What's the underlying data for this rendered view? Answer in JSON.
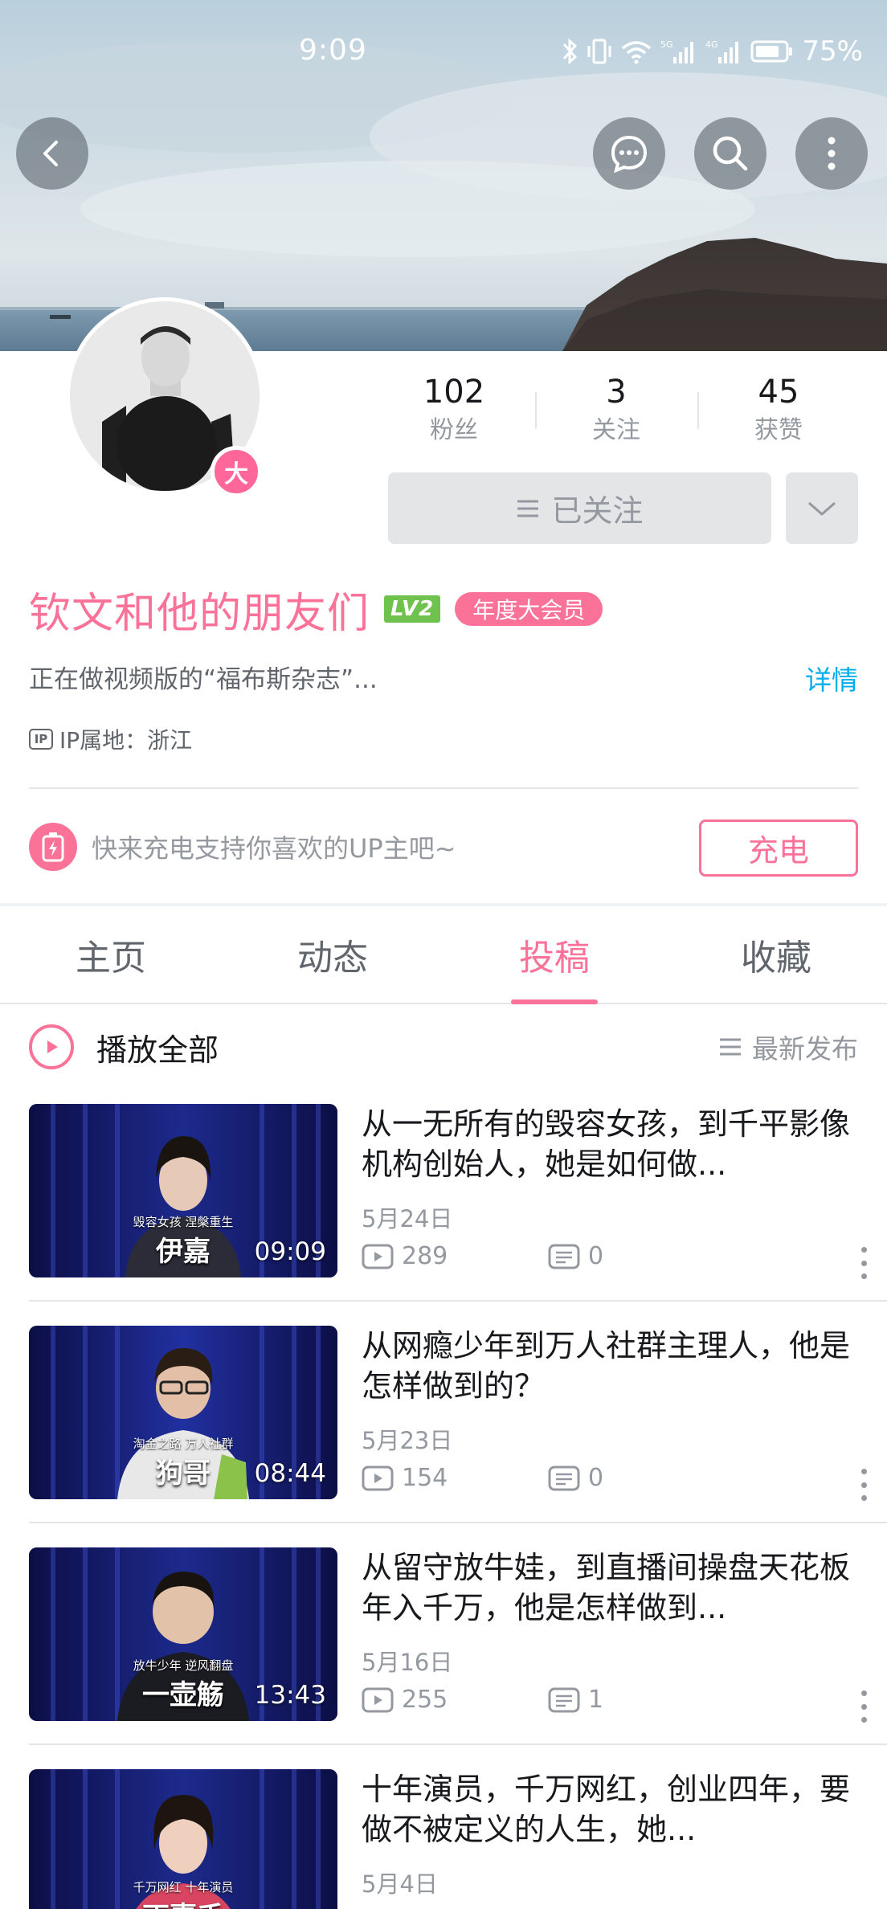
{
  "status_bar": {
    "time": "9:09",
    "battery": "75%"
  },
  "profile": {
    "avatar_badge": "大",
    "name": "钦文和他的朋友们",
    "level": "LV2",
    "vip": "年度大会员",
    "bio": "正在做视频版的“福布斯杂志”...",
    "bio_detail": "详情",
    "ip_icon": "IP",
    "ip": "IP属地：浙江"
  },
  "stats": [
    {
      "num": "102",
      "label": "粉丝"
    },
    {
      "num": "3",
      "label": "关注"
    },
    {
      "num": "45",
      "label": "获赞"
    }
  ],
  "follow_button": "已关注",
  "charge": {
    "text": "快来充电支持你喜欢的UP主吧~",
    "button": "充电"
  },
  "tabs": [
    "主页",
    "动态",
    "投稿",
    "收藏"
  ],
  "active_tab": "投稿",
  "play_all": "播放全部",
  "sort": "最新发布",
  "videos": [
    {
      "title": "从一无所有的毁容女孩，到千平影像机构创始人，她是如何做...",
      "caption_small": "毁容女孩 涅槃重生",
      "caption_big": "伊嘉",
      "duration": "09:09",
      "date": "5月24日",
      "views": "289",
      "comments": "0"
    },
    {
      "title": "从网瘾少年到万人社群主理人，他是怎样做到的？",
      "caption_small": "淘金之路 万人社群",
      "caption_big": "狗哥",
      "duration": "08:44",
      "date": "5月23日",
      "views": "154",
      "comments": "0"
    },
    {
      "title": "从留守放牛娃，到直播间操盘天花板年入千万，他是怎样做到...",
      "caption_small": "放牛少年 逆风翻盘",
      "caption_big": "一壶觞",
      "duration": "13:43",
      "date": "5月16日",
      "views": "255",
      "comments": "1"
    },
    {
      "title": "十年演员，千万网红，创业四年，要做不被定义的人生，她...",
      "caption_small": "千万网红 十年演员",
      "caption_big": "丁嘉千",
      "duration": "",
      "date": "5月4日",
      "views": "",
      "comments": ""
    }
  ],
  "colors": {
    "accent": "#fb7299",
    "link": "#00aeec",
    "muted": "#9499a0"
  }
}
